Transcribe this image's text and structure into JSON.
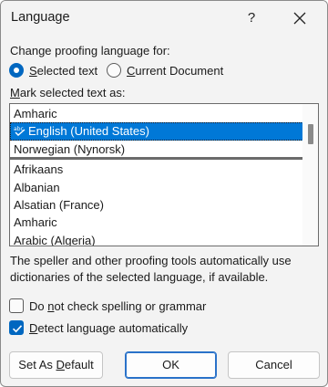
{
  "dialog": {
    "title": "Language",
    "help_label": "?",
    "close_icon": "close-icon"
  },
  "proofing": {
    "label": "Change proofing language for:",
    "options": [
      {
        "label_pre": "",
        "label_u": "S",
        "label_post": "elected text",
        "selected": true
      },
      {
        "label_pre": "",
        "label_u": "C",
        "label_post": "urrent Document",
        "selected": false
      }
    ]
  },
  "mark": {
    "label_u": "M",
    "label_post": "ark selected text as:"
  },
  "languages": {
    "items": [
      {
        "label": "Amharic"
      },
      {
        "label": "English (United States)",
        "selected": true,
        "icon": "spell-check-icon"
      },
      {
        "label": "Norwegian (Nynorsk)"
      },
      {
        "label": "Afrikaans"
      },
      {
        "label": "Albanian"
      },
      {
        "label": "Alsatian (France)"
      },
      {
        "label": "Amharic"
      },
      {
        "label": "Arabic (Algeria)"
      }
    ]
  },
  "description": "The speller and other proofing tools automatically use dictionaries of the selected language, if available.",
  "checks": [
    {
      "pre": "Do ",
      "u": "n",
      "post": "ot check spelling or grammar",
      "checked": false
    },
    {
      "pre": "",
      "u": "D",
      "post": "etect language automatically",
      "checked": true
    }
  ],
  "buttons": {
    "set_default_pre": "Set As ",
    "set_default_u": "D",
    "set_default_post": "efault",
    "ok": "OK",
    "cancel": "Cancel"
  },
  "colors": {
    "accent": "#0067c0",
    "selection": "#0078d7"
  }
}
